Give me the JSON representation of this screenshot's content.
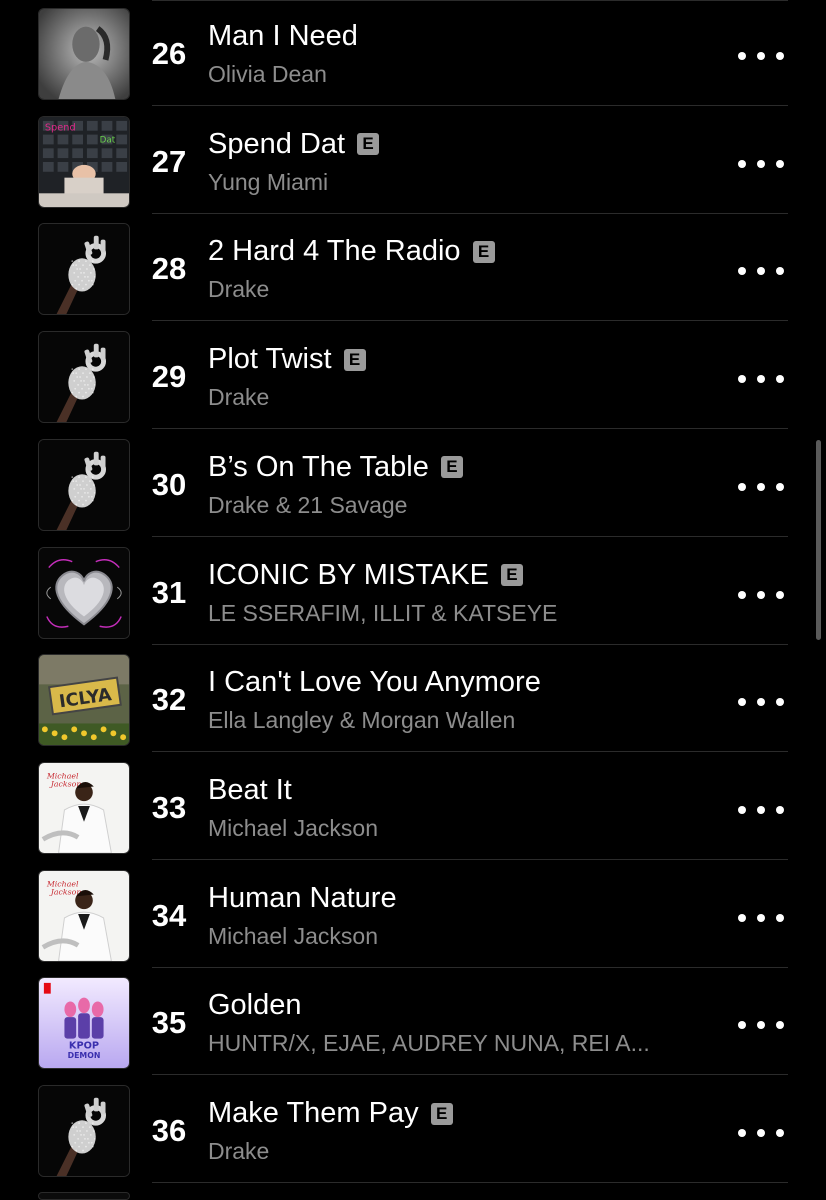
{
  "tracks": [
    {
      "rank": "26",
      "title": "Man I Need",
      "artist": "Olivia Dean",
      "explicit": false,
      "art": "olivia-dean-cover"
    },
    {
      "rank": "27",
      "title": "Spend Dat",
      "artist": "Yung Miami",
      "explicit": true,
      "art": "yung-miami-cover"
    },
    {
      "rank": "28",
      "title": "2 Hard 4 The Radio",
      "artist": "Drake",
      "explicit": true,
      "art": "drake-hand-cover"
    },
    {
      "rank": "29",
      "title": "Plot Twist",
      "artist": "Drake",
      "explicit": true,
      "art": "drake-hand-cover"
    },
    {
      "rank": "30",
      "title": "B’s On The Table",
      "artist": "Drake & 21 Savage",
      "explicit": true,
      "art": "drake-hand-cover"
    },
    {
      "rank": "31",
      "title": "ICONIC BY MISTAKE",
      "artist": "LE SSERAFIM, ILLIT & KATSEYE",
      "explicit": true,
      "art": "heart-cover"
    },
    {
      "rank": "32",
      "title": "I Can't Love You Anymore",
      "artist": "Ella Langley & Morgan Wallen",
      "explicit": false,
      "art": "iclya-cover"
    },
    {
      "rank": "33",
      "title": "Beat It",
      "artist": "Michael Jackson",
      "explicit": false,
      "art": "thriller-cover"
    },
    {
      "rank": "34",
      "title": "Human Nature",
      "artist": "Michael Jackson",
      "explicit": false,
      "art": "thriller-cover"
    },
    {
      "rank": "35",
      "title": "Golden",
      "artist": "HUNTR/X, EJAE, AUDREY NUNA, REI A...",
      "explicit": false,
      "art": "kpop-demon-hunters-cover"
    },
    {
      "rank": "36",
      "title": "Make Them Pay",
      "artist": "Drake",
      "explicit": true,
      "art": "drake-hand-cover"
    }
  ],
  "explicit_badge": "E",
  "plate_text": "ICLYA",
  "colors": {
    "background": "#000000",
    "primary_text": "#ffffff",
    "secondary_text": "#8d8d8d",
    "badge": "#9a9a9a",
    "separator": "#2b2b2b"
  }
}
